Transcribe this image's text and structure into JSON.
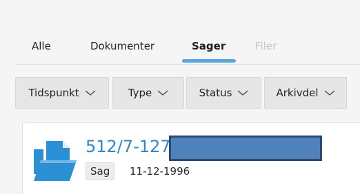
{
  "tabs": [
    {
      "label": "Alle",
      "state": "normal"
    },
    {
      "label": "Dokumenter",
      "state": "normal"
    },
    {
      "label": "Sager",
      "state": "active"
    },
    {
      "label": "Filer",
      "state": "disabled"
    }
  ],
  "filters": [
    {
      "label": "Tidspunkt",
      "icon": "chevron-down-icon"
    },
    {
      "label": "Type",
      "icon": "chevron-down-icon"
    },
    {
      "label": "Status",
      "icon": "chevron-down-icon"
    },
    {
      "label": "Arkivdel",
      "icon": "chevron-down-icon"
    }
  ],
  "result": {
    "case_number": "512/7-127",
    "type": "Sag",
    "date": "11-12-1996",
    "icon": "folder-icon"
  },
  "colors": {
    "accent": "#5aa6dc",
    "link": "#2e87c6",
    "icon": "#2b8fd6",
    "redaction": "#4f81bd"
  }
}
